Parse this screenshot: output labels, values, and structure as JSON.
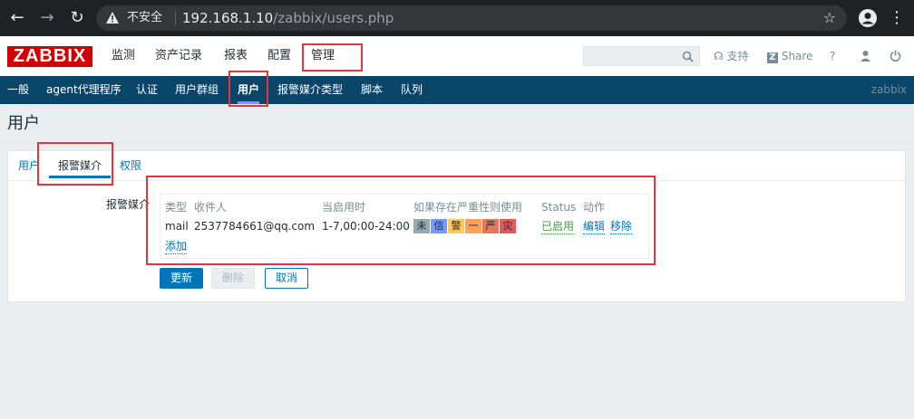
{
  "browser": {
    "insecure_label": "不安全",
    "url_host": "192.168.1.10",
    "url_path": "/zabbix/users.php"
  },
  "header": {
    "logo": "ZABBIX",
    "menu": [
      "监测",
      "资产记录",
      "报表",
      "配置",
      "管理"
    ],
    "search_placeholder": "",
    "support_label": "支持",
    "share_badge": "Z",
    "share_label": "Share",
    "help_label": "?"
  },
  "subnav": {
    "items": [
      "一般",
      "agent代理程序",
      "认证",
      "用户群组",
      "用户",
      "报警媒介类型",
      "脚本",
      "队列"
    ],
    "active": "用户",
    "server_name": "zabbix"
  },
  "page": {
    "title": "用户",
    "tabs": [
      "用户",
      "报警媒介",
      "权限"
    ],
    "active_tab": "报警媒介",
    "media_label": "报警媒介",
    "media_table": {
      "columns": [
        "类型",
        "收件人",
        "当启用时",
        "如果存在严重性则使用",
        "Status",
        "动作"
      ],
      "rows": [
        {
          "type": "mail",
          "send_to": "2537784661@qq.com",
          "when_active": "1-7,00:00-24:00",
          "severities": [
            "未",
            "信",
            "警",
            "一",
            "严",
            "灾"
          ],
          "status": "已启用",
          "actions": [
            "编辑",
            "移除"
          ]
        }
      ],
      "add_label": "添加"
    },
    "buttons": {
      "update": "更新",
      "delete": "删除",
      "cancel": "取消"
    }
  },
  "colors": {
    "severity": [
      "#97aab3",
      "#7499ff",
      "#ffc859",
      "#ffa059",
      "#e97659",
      "#e45959"
    ],
    "accent": "#0275b8",
    "nav_bg": "#0a466a",
    "logo_bg": "#d40000",
    "annotation": "#e8333a"
  }
}
